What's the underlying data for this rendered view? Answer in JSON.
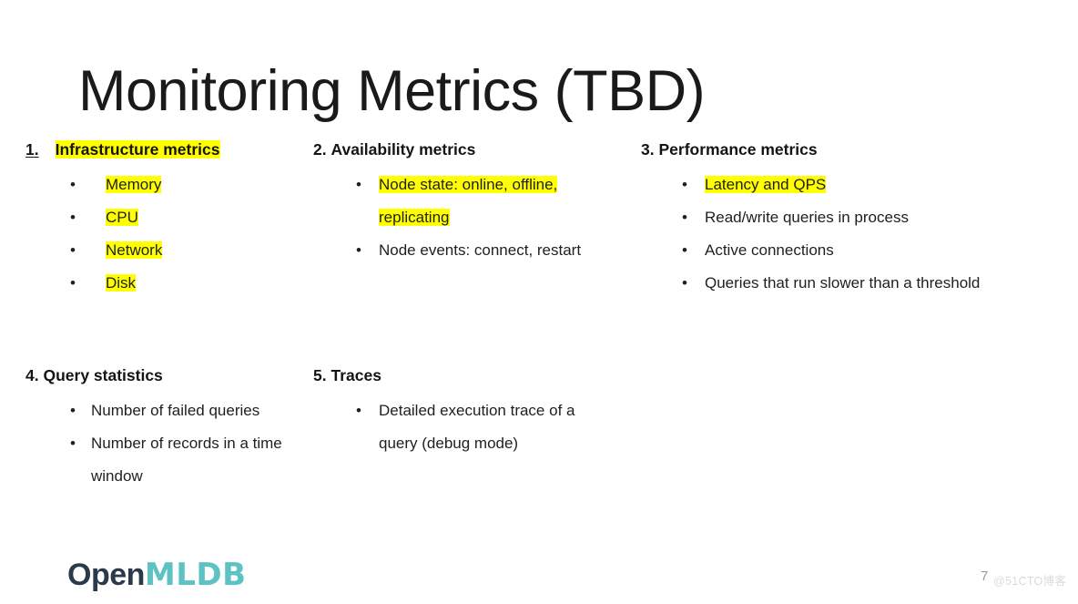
{
  "slide": {
    "title": "Monitoring Metrics (TBD)",
    "page_number": "7",
    "watermark": "@51CTO博客",
    "background_color": "#ffffff",
    "highlight_color": "#ffff00"
  },
  "logo": {
    "part1": "Open",
    "part2": "MLDB",
    "part1_color": "#2b3a4a",
    "part2_color": "#5cc2c4"
  },
  "sections": [
    {
      "number": "1.",
      "title": "Infrastructure metrics",
      "title_highlighted": true,
      "number_underlined": true,
      "bullets": [
        {
          "text": "Memory",
          "highlighted": true
        },
        {
          "text": "CPU",
          "highlighted": true
        },
        {
          "text": "Network",
          "highlighted": true
        },
        {
          "text": "Disk",
          "highlighted": true
        }
      ]
    },
    {
      "number": "2.",
      "title": "Availability metrics",
      "title_highlighted": false,
      "number_underlined": false,
      "bullets": [
        {
          "text": "Node state: online, offline, replicating",
          "highlighted": true
        },
        {
          "text": "Node events: connect, restart",
          "highlighted": false
        }
      ]
    },
    {
      "number": "3.",
      "title": "Performance metrics",
      "title_highlighted": false,
      "number_underlined": false,
      "bullets": [
        {
          "text": "Latency and QPS",
          "highlighted": true
        },
        {
          "text": "Read/write queries in process",
          "highlighted": false
        },
        {
          "text": "Active connections",
          "highlighted": false
        },
        {
          "text": "Queries that run slower than a threshold",
          "highlighted": false
        }
      ]
    },
    {
      "number": "4.",
      "title": "Query statistics",
      "title_highlighted": false,
      "number_underlined": false,
      "bullets": [
        {
          "text": "Number of failed queries",
          "highlighted": false
        },
        {
          "text": "Number of records in a time window",
          "highlighted": false
        }
      ]
    },
    {
      "number": "5.",
      "title": "Traces",
      "title_highlighted": false,
      "number_underlined": false,
      "bullets": [
        {
          "text": "Detailed execution trace of a query (debug mode)",
          "highlighted": false
        }
      ]
    }
  ],
  "bullet_glyph": "•"
}
